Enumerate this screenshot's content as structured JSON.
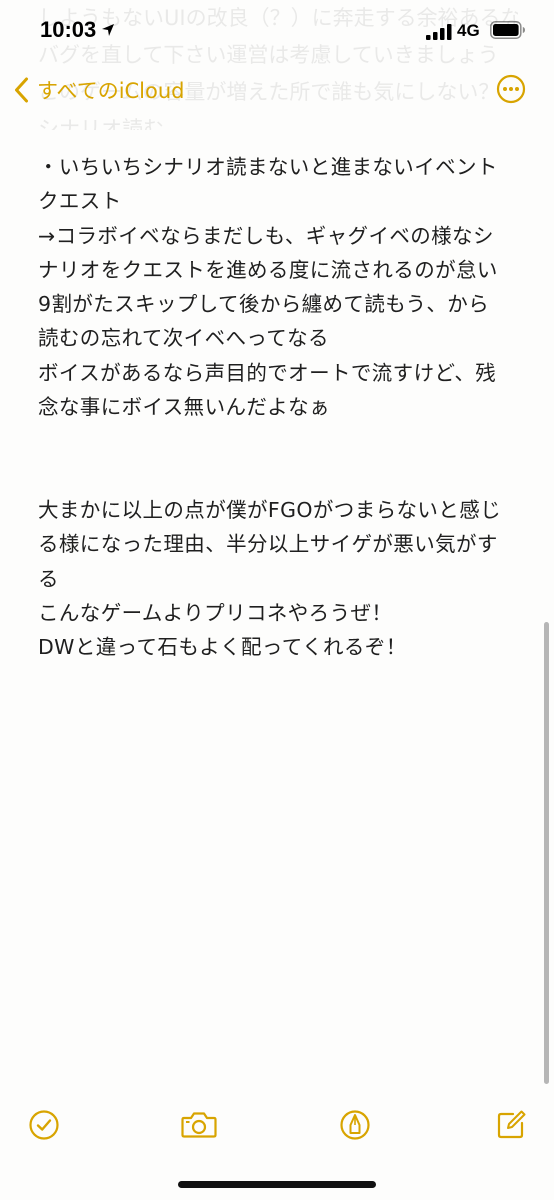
{
  "status_bar": {
    "time": "10:03",
    "network": "4G"
  },
  "nav": {
    "back_label": "すべてのiCloud"
  },
  "scrolled_hidden_text": [
    "しようもないUIの改良（？）に奔走する余裕あるなら",
    "バグを直して下さい運営は考慮していきましょう",
    "このゲームの容量が増えた所で誰も気にしない？",
    "シナリオ読む"
  ],
  "note_lines": [
    "・いちいちシナリオ読まないと進まないイベント",
    "クエスト",
    "→コラボイベならまだしも、ギャグイベの様なシ",
    "ナリオをクエストを進める度に流されるのが怠い",
    "9割がたスキップして後から纏めて読もう、から",
    "読むの忘れて次イベへってなる",
    "ボイスがあるなら声目的でオートで流すけど、残",
    "念な事にボイス無いんだよなぁ",
    "",
    "",
    "大まかに以上の点が僕がFGOがつまらないと感じ",
    "る様になった理由、半分以上サイゲが悪い気がす",
    "る",
    "こんなゲームよりプリコネやろうぜ！",
    "DWと違って石もよく配ってくれるぞ！"
  ],
  "toolbar": {
    "icons": [
      "checklist-icon",
      "camera-icon",
      "markup-pen-icon",
      "compose-icon"
    ]
  },
  "accent_color": "#d8a400"
}
